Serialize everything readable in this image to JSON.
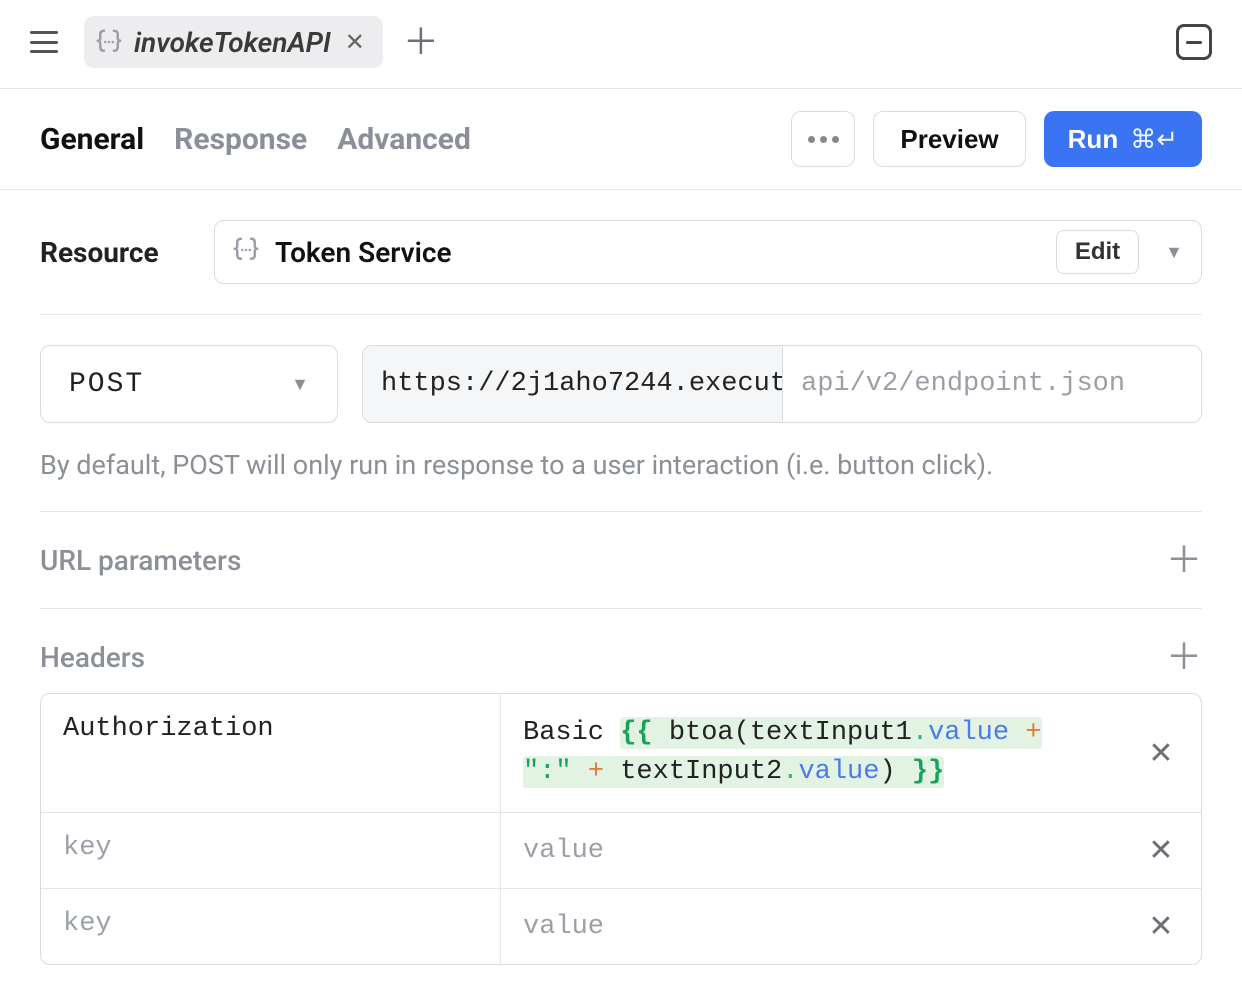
{
  "topbar": {
    "tab_title": "invokeTokenAPI"
  },
  "tabs": {
    "general": "General",
    "response": "Response",
    "advanced": "Advanced",
    "active": "general"
  },
  "actions": {
    "preview": "Preview",
    "run": "Run",
    "run_shortcut": "⌘↵"
  },
  "resource": {
    "label": "Resource",
    "name": "Token Service",
    "edit": "Edit"
  },
  "request": {
    "method": "POST",
    "base_url": "https://2j1aho7244.execut",
    "path_placeholder": "api/v2/endpoint.json",
    "path_value": "",
    "hint": "By default, POST will only run in response to a user interaction (i.e. button click)."
  },
  "sections": {
    "url_params": "URL parameters",
    "headers": "Headers"
  },
  "headers": {
    "rows": [
      {
        "key": "Authorization",
        "value_prefix": "Basic ",
        "expr": {
          "open": "{{",
          "fn": "btoa",
          "arg_a_obj": "textInput1",
          "arg_a_prop": "value",
          "plus1": "+",
          "literal": "\":\"",
          "plus2": "+",
          "arg_b_obj": "textInput2",
          "arg_b_prop": "value",
          "close": "}}"
        },
        "placeholder": false
      },
      {
        "key": "key",
        "value": "value",
        "placeholder": true
      },
      {
        "key": "key",
        "value": "value",
        "placeholder": true
      }
    ]
  }
}
